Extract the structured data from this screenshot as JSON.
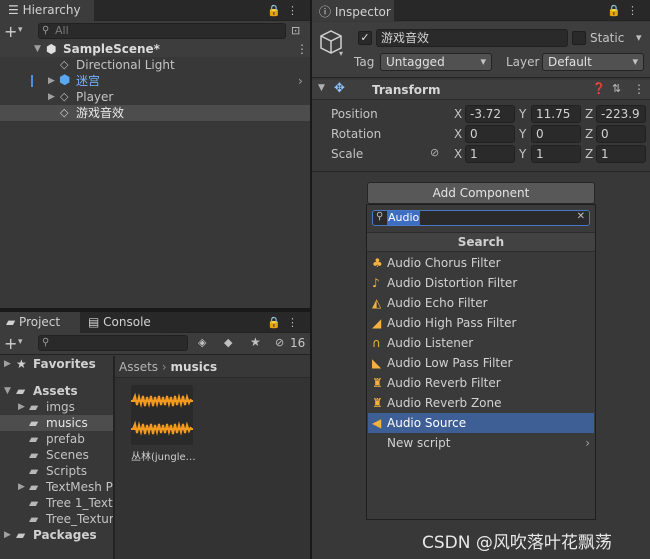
{
  "hierarchy": {
    "tab_label": "Hierarchy",
    "search_placeholder": "All",
    "scene_name": "SampleScene*",
    "items": [
      "Directional Light",
      "迷宫",
      "Player",
      "游戏音效"
    ]
  },
  "inspector": {
    "tab_label": "Inspector",
    "object_name": "游戏音效",
    "static_label": "Static",
    "tag_label": "Tag",
    "tag_value": "Untagged",
    "layer_label": "Layer",
    "layer_value": "Default",
    "transform": {
      "title": "Transform",
      "rows": [
        {
          "label": "Position",
          "x": "-3.72",
          "y": "11.75",
          "z": "-223.9"
        },
        {
          "label": "Rotation",
          "x": "0",
          "y": "0",
          "z": "0"
        },
        {
          "label": "Scale",
          "x": "1",
          "y": "1",
          "z": "1"
        }
      ],
      "axis_x": "X",
      "axis_y": "Y",
      "axis_z": "Z"
    },
    "add_component": {
      "button_label": "Add Component",
      "search_value": "Audio",
      "section_title": "Search",
      "items": [
        "Audio Chorus Filter",
        "Audio Distortion Filter",
        "Audio Echo Filter",
        "Audio High Pass Filter",
        "Audio Listener",
        "Audio Low Pass Filter",
        "Audio Reverb Filter",
        "Audio Reverb Zone",
        "Audio Source",
        "New script"
      ],
      "highlighted": "Audio Source"
    }
  },
  "project": {
    "tabs": [
      "Project",
      "Console"
    ],
    "hidden_count": "16",
    "breadcrumb": [
      "Assets",
      "musics"
    ],
    "tree": {
      "favorites": "Favorites",
      "assets": "Assets",
      "folders": [
        "imgs",
        "musics",
        "prefab",
        "Scenes",
        "Scripts",
        "TextMesh P",
        "Tree 1_Textu",
        "Tree_Textur"
      ],
      "packages": "Packages"
    },
    "asset": {
      "name": "丛林(jungle…"
    }
  },
  "watermark": "CSDN @风吹落叶花飘荡",
  "colors": {
    "accent_selection": "#3e5f96",
    "audio_icon": "#f4b13e",
    "scene_icon": "#e0e0e0"
  }
}
